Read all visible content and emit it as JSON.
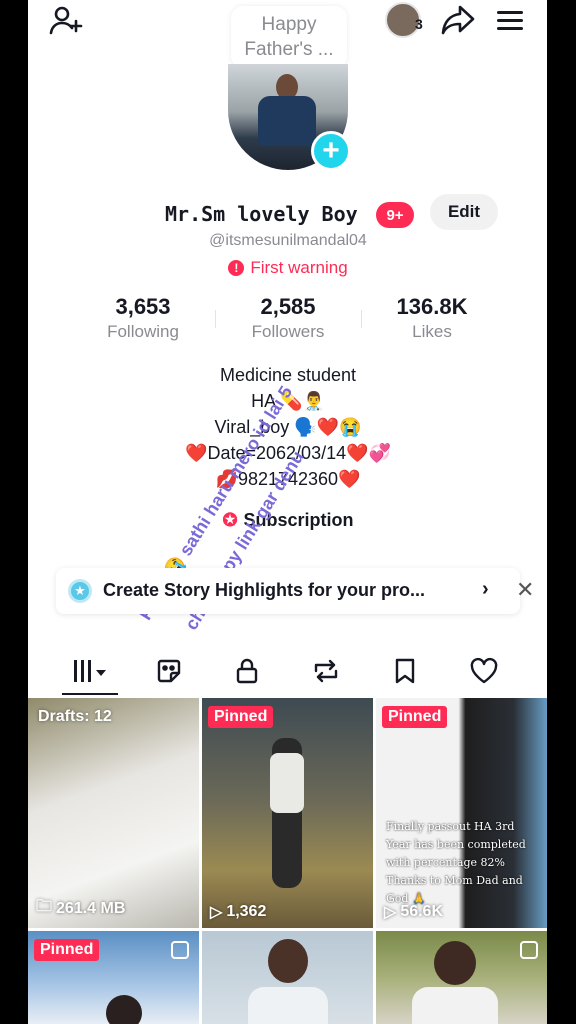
{
  "note": {
    "line1": "Happy",
    "line2": "Father's ..."
  },
  "story": {
    "count": "3"
  },
  "profile": {
    "display_name": "Mr.Sm lovely Boy",
    "badge": "9+",
    "edit_label": "Edit",
    "username": "@itsmesunilmandal04",
    "warning": "First warning"
  },
  "stats": [
    {
      "value": "3,653",
      "label": "Following"
    },
    {
      "value": "2,585",
      "label": "Followers"
    },
    {
      "value": "136.8K",
      "label": "Likes"
    }
  ],
  "bio": {
    "line1": "Medicine student",
    "line2": "HA 💊👨‍⚕️",
    "line3": "Viral_boy 🗣️❤️😭",
    "line4": "❤️Date=2062/03/14❤️💞",
    "line5": "💋9821742360❤️"
  },
  "subscription_label": "Subscription",
  "overlay": {
    "line1": "Plz🙏😭 sathi haru mero id lai 5",
    "line2": "choti copy link gar denu"
  },
  "highlight_banner": {
    "text": "Create Story Highlights for your pro..."
  },
  "tabs": [
    "videos",
    "favorites",
    "private",
    "reposts",
    "saved",
    "liked"
  ],
  "grid": {
    "tiles": [
      {
        "tag": "Drafts: 12",
        "meta": "261.4 MB",
        "meta_icon": "folder-icon",
        "color": "#d9d6cf"
      },
      {
        "tag": "Pinned",
        "meta": "1,362",
        "meta_icon": "play-icon",
        "color": "#7b6a40"
      },
      {
        "tag": "Pinned",
        "meta": "56.6K",
        "meta_icon": "play-icon",
        "color": "#3a3a3a"
      },
      {
        "tag": "Pinned",
        "meta": "",
        "meta_icon": "copy-icon",
        "color": "#4a7aa8"
      },
      {
        "tag": "",
        "meta": "",
        "meta_icon": "",
        "color": "#c9d3db"
      },
      {
        "tag": "",
        "meta": "",
        "meta_icon": "copy-icon",
        "color": "#8a9a6a"
      }
    ],
    "card_text": "Finally passout HA 3rd Year has been completed with percentage 82% Thanks to Mom Dad and God 🙏"
  }
}
